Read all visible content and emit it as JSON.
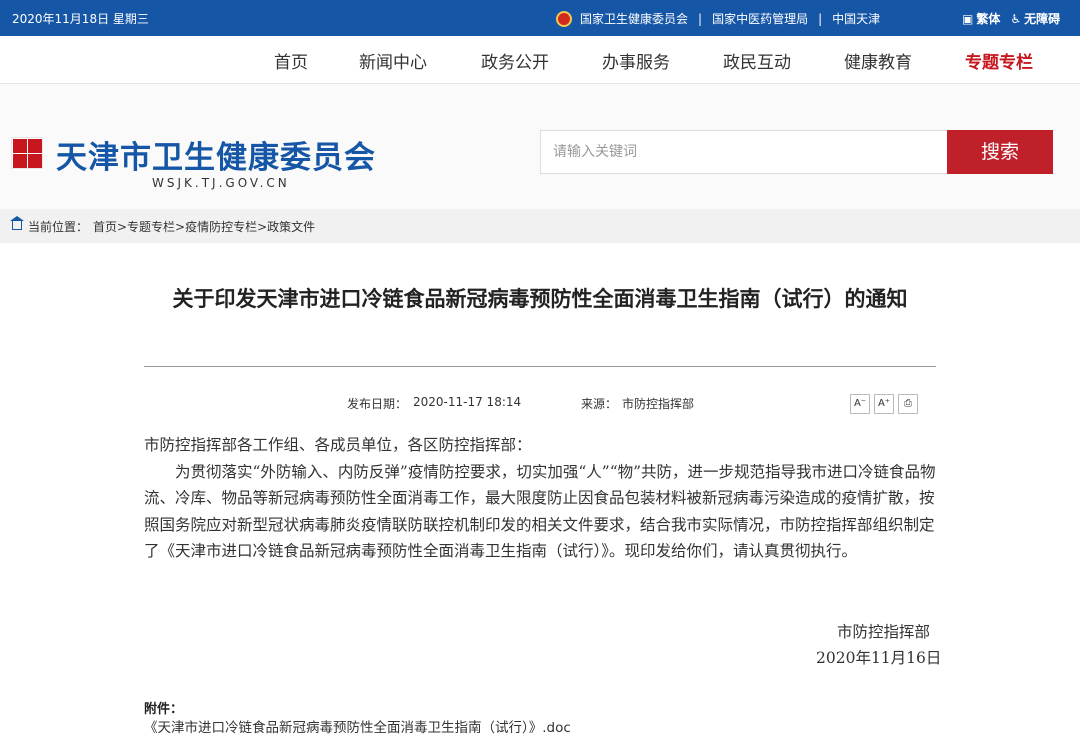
{
  "topbar": {
    "date": "2020年11月18日 星期三",
    "links": [
      "国家卫生健康委员会",
      "国家中医药管理局",
      "中国天津"
    ],
    "traditional": "繁体",
    "accessible": "无障碍"
  },
  "nav": [
    "首页",
    "新闻中心",
    "政务公开",
    "办事服务",
    "政民互动",
    "健康教育",
    "专题专栏"
  ],
  "header": {
    "title": "天津市卫生健康委员会",
    "domain": "WSJK.TJ.GOV.CN",
    "search_placeholder": "请输入关键词",
    "search_button": "搜索"
  },
  "breadcrumb": {
    "label": "当前位置：",
    "path": "首页>专题专栏>疫情防控专栏>政策文件"
  },
  "article": {
    "title": "关于印发天津市进口冷链食品新冠病毒预防性全面消毒卫生指南（试行）的通知",
    "date_label": "发布日期：",
    "date": "2020-11-17 18:14",
    "source_label": "来源：",
    "source": "市防控指挥部",
    "font_decrease": "A⁻",
    "font_increase": "A⁺",
    "salutation": "市防控指挥部各工作组、各成员单位，各区防控指挥部：",
    "paragraph": "为贯彻落实“外防输入、内防反弹”疫情防控要求，切实加强“人”“物”共防，进一步规范指导我市进口冷链食品物流、冷库、物品等新冠病毒预防性全面消毒工作，最大限度防止因食品包装材料被新冠病毒污染造成的疫情扩散，按照国务院应对新型冠状病毒肺炎疫情联防联控机制印发的相关文件要求，结合我市实际情况，市防控指挥部组织制定了《天津市进口冷链食品新冠病毒预防性全面消毒卫生指南（试行）》。现印发给你们，请认真贯彻执行。",
    "signature": "市防控指挥部",
    "sign_date": "2020年11月16日",
    "attachment_label": "附件：",
    "attachment": "《天津市进口冷链食品新冠病毒预防性全面消毒卫生指南（试行）》.doc"
  },
  "colors": {
    "brand_blue": "#1556a6",
    "accent_red": "#c0202a"
  }
}
